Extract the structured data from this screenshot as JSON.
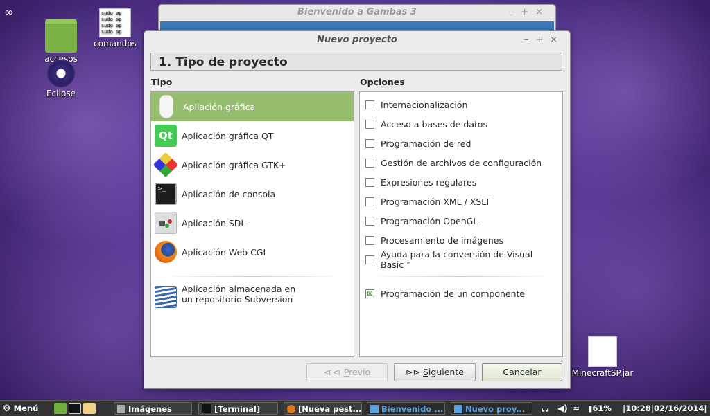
{
  "desktop": {
    "icons": [
      {
        "label": "accesos"
      },
      {
        "label": "comandos",
        "file_lines": [
          "sudo ap",
          "sudo ap",
          "sudo ap",
          "sudo ap"
        ]
      },
      {
        "label": "Eclipse"
      },
      {
        "label": "MinecraftSP.jar"
      }
    ],
    "system_glyph": "∞"
  },
  "background_window": {
    "title": "Bienvenido a Gambas 3",
    "controls": [
      "–",
      "+",
      "×"
    ]
  },
  "dialog": {
    "title": "Nuevo proyecto",
    "controls": [
      "–",
      "+",
      "×"
    ],
    "step_heading": "1. Tipo de proyecto",
    "tipo": {
      "header": "Tipo",
      "items": [
        {
          "label": "Apliación gráfica",
          "icon": "mouse-icon",
          "selected": true
        },
        {
          "label": "Aplicación gráfica QT",
          "icon": "qt-icon",
          "glyph": "Qt"
        },
        {
          "label": "Aplicación gráfica GTK+",
          "icon": "gtk-icon"
        },
        {
          "label": "Aplicación de consola",
          "icon": "terminal-icon",
          "glyph": ">_"
        },
        {
          "label": "Aplicación SDL",
          "icon": "gamepad-icon"
        },
        {
          "label": "Aplicación Web CGI",
          "icon": "firefox-icon"
        }
      ],
      "svn_item": {
        "line1": "Aplicación almacenada en",
        "line2": "un repositorio Subversion",
        "icon": "subversion-icon"
      }
    },
    "opciones": {
      "header": "Opciones",
      "items": [
        {
          "label": "Internacionalización",
          "checked": false
        },
        {
          "label": "Acceso a bases de datos",
          "checked": false
        },
        {
          "label": "Programación de red",
          "checked": false
        },
        {
          "label": "Gestión de archivos de configuración",
          "checked": false
        },
        {
          "label": "Expresiones regulares",
          "checked": false
        },
        {
          "label": "Programación XML / XSLT",
          "checked": false
        },
        {
          "label": "Programación OpenGL",
          "checked": false
        },
        {
          "label": "Procesamiento de imágenes",
          "checked": false
        },
        {
          "label": "Ayuda para la conversión de Visual Basic™",
          "checked": false
        }
      ],
      "component_item": {
        "label": "Programación de un componente",
        "checked": true
      }
    },
    "buttons": {
      "previous": {
        "glyph": "⧏⧏",
        "label_pre": "",
        "mnemonic": "P",
        "label_post": "revio",
        "enabled": false
      },
      "next": {
        "glyph": "⊳⊳",
        "label_pre": "",
        "mnemonic": "S",
        "label_post": "iguiente",
        "enabled": true
      },
      "cancel": {
        "label": "Cancelar"
      }
    }
  },
  "taskbar": {
    "menu_label": "Menú",
    "tasks": [
      {
        "label": "Imágenes"
      },
      {
        "label": "[Terminal]"
      },
      {
        "label": "[Nueva pest..."
      },
      {
        "label": "Bienvenido ..."
      },
      {
        "label": "Nuevo proy..."
      }
    ],
    "battery": "61%",
    "clock": "|10:28|02/16/2014|"
  },
  "colors": {
    "selection_green": "#97bd6e",
    "active_task_blue": "#5aa2e0"
  }
}
